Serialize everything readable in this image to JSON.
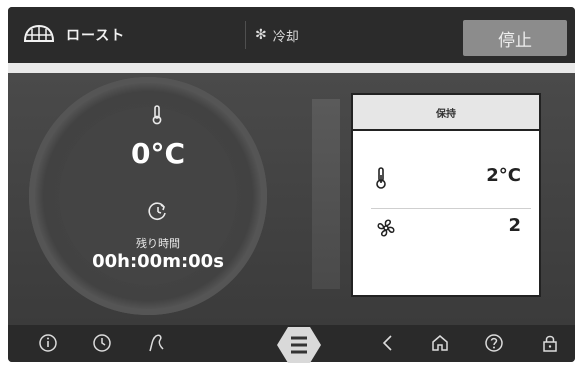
{
  "header": {
    "mode_icon": "roast-grill-icon",
    "mode_label": "ロースト",
    "cool_icon": "snowflake-icon",
    "cool_label": "冷却",
    "stop_label": "停止"
  },
  "dial": {
    "temperature": "0°C",
    "remaining_label": "残り時間",
    "remaining_time": "00h:00m:00s"
  },
  "panel": {
    "title": "保持",
    "temperature": "2°C",
    "fan_speed": "2"
  },
  "nav": {
    "icons": [
      "info-icon",
      "clock-icon",
      "probe-icon",
      "menu-icon",
      "back-icon",
      "home-icon",
      "help-icon",
      "lock-icon"
    ]
  }
}
